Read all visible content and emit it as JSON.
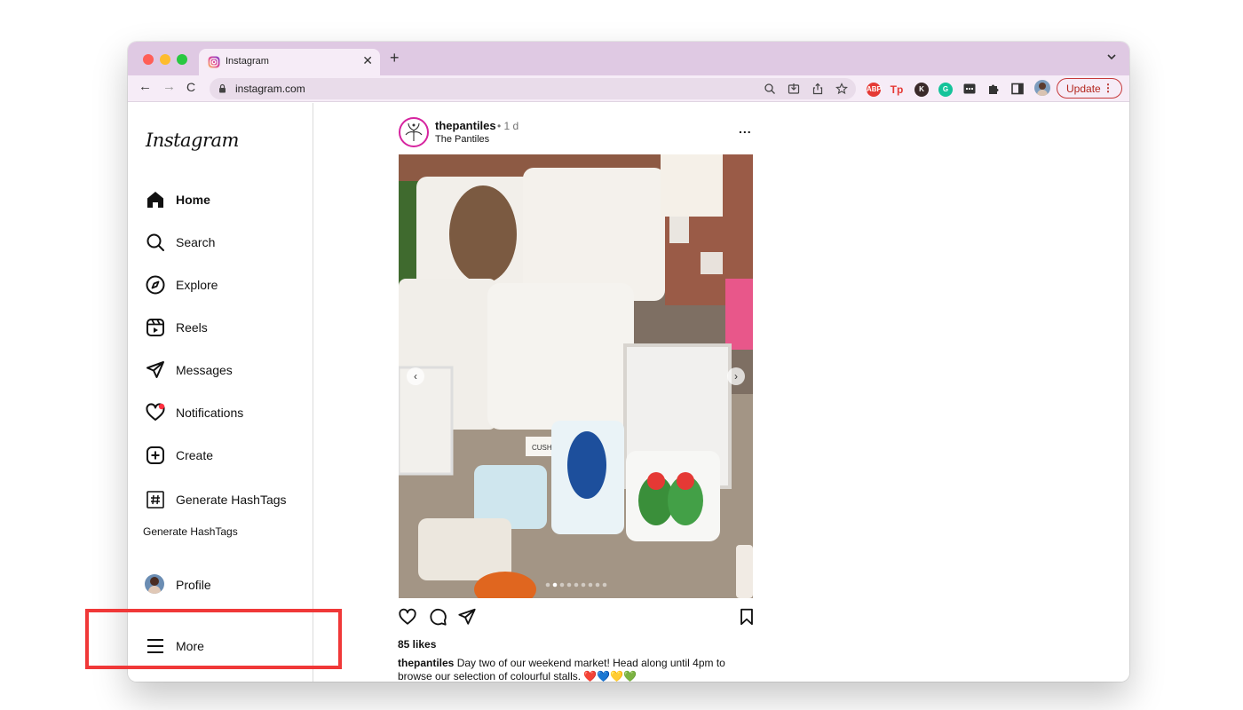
{
  "browser": {
    "tab_title": "Instagram",
    "url": "instagram.com",
    "update_label": "Update",
    "extensions": [
      "ABP",
      "Tp",
      "K",
      "G"
    ]
  },
  "sidebar": {
    "logo": "Instagram",
    "items": [
      {
        "label": "Home",
        "icon": "home-icon"
      },
      {
        "label": "Search",
        "icon": "search-icon"
      },
      {
        "label": "Explore",
        "icon": "compass-icon"
      },
      {
        "label": "Reels",
        "icon": "reels-icon"
      },
      {
        "label": "Messages",
        "icon": "send-icon"
      },
      {
        "label": "Notifications",
        "icon": "heart-icon"
      },
      {
        "label": "Create",
        "icon": "plus-square-icon"
      },
      {
        "label": "Generate HashTags",
        "icon": "hashtag-icon"
      },
      {
        "label": "Profile",
        "icon": "avatar"
      },
      {
        "label": "More",
        "icon": "hamburger-icon"
      }
    ],
    "hashtag_sub_label": "Generate HashTags"
  },
  "post": {
    "username": "thepantiles",
    "time": "• 1 d",
    "location": "The Pantiles",
    "more_label": "...",
    "likes": "85 likes",
    "caption_user": "thepantiles",
    "caption_text": " Day two of our weekend market! Head along until 4pm to browse our selection of colourful stalls. ❤️💙💛💚",
    "photo_sign": "CUSHIO",
    "carousel_count": 9,
    "carousel_index": 1
  },
  "colors": {
    "highlight": "#f03838",
    "tabbar": "#dfc9e3",
    "toolbar": "#f6ecf7"
  }
}
